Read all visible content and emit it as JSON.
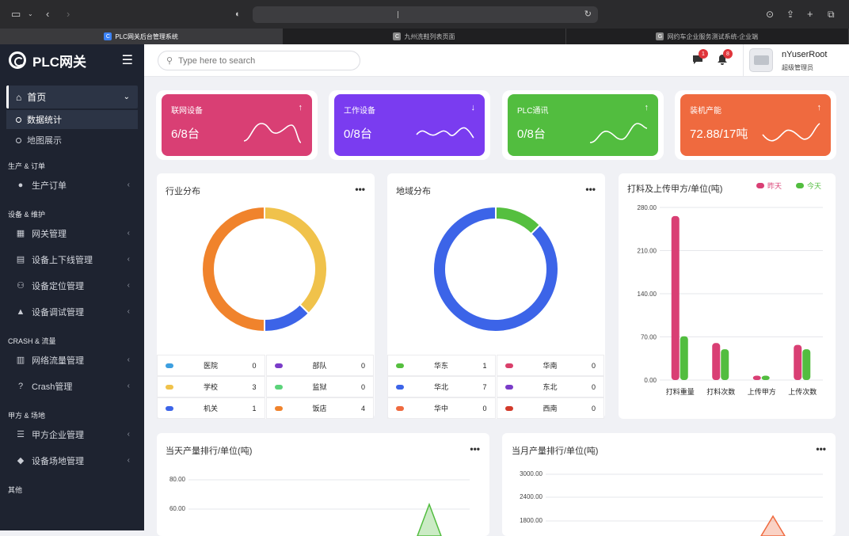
{
  "browser": {
    "tabs": [
      {
        "label": "PLC网关后台管理系统",
        "fav": "C"
      },
      {
        "label": "九州洗鞋列表页面",
        "fav": "C"
      },
      {
        "label": "网约车企业服务测试系统-企业端",
        "fav": "G"
      }
    ]
  },
  "sidebar": {
    "brand": "PLC网关",
    "home": "首页",
    "home_subs": [
      "数据统计",
      "地图展示"
    ],
    "groups": [
      {
        "title": "生产 & 订单",
        "items": [
          {
            "label": "生产订单",
            "icon": "drop-icon"
          }
        ]
      },
      {
        "title": "设备 & 维护",
        "items": [
          {
            "label": "网关管理",
            "icon": "grid-icon"
          },
          {
            "label": "设备上下线管理",
            "icon": "stamp-icon"
          },
          {
            "label": "设备定位管理",
            "icon": "user-icon"
          },
          {
            "label": "设备调试管理",
            "icon": "warning-icon"
          }
        ]
      },
      {
        "title": "CRASH & 流量",
        "items": [
          {
            "label": "网络流量管理",
            "icon": "bar-chart-icon"
          },
          {
            "label": "Crash管理",
            "icon": "question-icon"
          }
        ]
      },
      {
        "title": "甲方 & 场地",
        "items": [
          {
            "label": "甲方企业管理",
            "icon": "user-list-icon"
          },
          {
            "label": "设备场地管理",
            "icon": "tag-icon"
          }
        ]
      },
      {
        "title": "其他",
        "items": []
      }
    ]
  },
  "header": {
    "search_placeholder": "Type here to search",
    "msg_count": "1",
    "bell_count": "8",
    "username": "nYuserRoot",
    "role": "超级管理员"
  },
  "stats": [
    {
      "title": "联网设备",
      "value": "6/8台",
      "arrow": "↑",
      "color": "#d93f74"
    },
    {
      "title": "工作设备",
      "value": "0/8台",
      "arrow": "↓",
      "color": "#7a3cf0"
    },
    {
      "title": "PLC通讯",
      "value": "0/8台",
      "arrow": "↑",
      "color": "#52bd3f"
    },
    {
      "title": "装机产能",
      "value": "72.88/17吨",
      "arrow": "↑",
      "color": "#ef6a3f"
    }
  ],
  "industry": {
    "title": "行业分布",
    "chart_data": {
      "type": "pie",
      "slices": [
        {
          "name": "医院",
          "value": 0,
          "color": "#3d9fe0"
        },
        {
          "name": "部队",
          "value": 0,
          "color": "#7a3cc8"
        },
        {
          "name": "学校",
          "value": 3,
          "color": "#f0c24b"
        },
        {
          "name": "监狱",
          "value": 0,
          "color": "#5bd37a"
        },
        {
          "name": "机关",
          "value": 1,
          "color": "#3c64e8"
        },
        {
          "name": "饭店",
          "value": 4,
          "color": "#f0832c"
        }
      ]
    }
  },
  "region": {
    "title": "地域分布",
    "chart_data": {
      "type": "pie",
      "slices": [
        {
          "name": "华东",
          "value": 1,
          "color": "#55bf3f"
        },
        {
          "name": "华南",
          "value": 0,
          "color": "#d93f6a"
        },
        {
          "name": "华北",
          "value": 7,
          "color": "#3c64e8"
        },
        {
          "name": "东北",
          "value": 0,
          "color": "#7a3cc8"
        },
        {
          "name": "华中",
          "value": 0,
          "color": "#ef6a3f"
        },
        {
          "name": "西南",
          "value": 0,
          "color": "#d23a2a"
        }
      ]
    }
  },
  "upload": {
    "title": "打料及上传甲方/单位(吨)",
    "chart_data": {
      "type": "bar",
      "categories": [
        "打料重量",
        "打料次数",
        "上传甲方",
        "上传次数"
      ],
      "series": [
        {
          "name": "昨天",
          "values": [
            266,
            60,
            7,
            57
          ],
          "color": "#d93f74"
        },
        {
          "name": "今天",
          "values": [
            71,
            50,
            7,
            50
          ],
          "color": "#52bd3f"
        }
      ],
      "yticks": [
        "0.00",
        "70.00",
        "140.00",
        "210.00",
        "280.00"
      ],
      "ylim": [
        0,
        280
      ]
    }
  },
  "daily": {
    "title": "当天产量排行/单位(吨)",
    "chart_data": {
      "type": "area",
      "yticks": [
        "80.00",
        "60.00"
      ],
      "color": "#52bd3f"
    }
  },
  "monthly": {
    "title": "当月产量排行/单位(吨)",
    "chart_data": {
      "type": "area",
      "yticks": [
        "3000.00",
        "2400.00",
        "1800.00"
      ],
      "color": "#ef6a3f"
    }
  }
}
